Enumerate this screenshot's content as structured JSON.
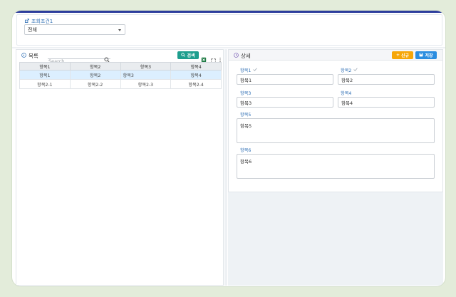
{
  "colors": {
    "accent_navy": "#2c3d9c",
    "label_blue": "#2f6fb5",
    "search_button": "#1e9e8e",
    "new_button": "#f6a609",
    "save_button": "#2b8de0",
    "selected_row": "#dcefff"
  },
  "condition": {
    "title": "조회조건1",
    "select_value": "전체"
  },
  "list_panel": {
    "title": "목록",
    "search_placeholder": "Search",
    "search_button_label": "검색",
    "columns": [
      "항목1",
      "항목2",
      "항목3",
      "항목4"
    ],
    "rows": [
      [
        "항목1",
        "항목2",
        "항목3",
        "항목4"
      ],
      [
        "항목2-1",
        "항목2-2",
        "항목2-3",
        "항목2-4"
      ]
    ]
  },
  "detail_panel": {
    "title": "상세",
    "new_button_label": "신규",
    "save_button_label": "저장",
    "fields": [
      {
        "label": "항목1",
        "value": "항목1"
      },
      {
        "label": "항목2",
        "value": "항목2"
      },
      {
        "label": "항목3",
        "value": "항목3"
      },
      {
        "label": "항목4",
        "value": "항목4"
      },
      {
        "label": "항목5",
        "value": "항목5"
      },
      {
        "label": "항목6",
        "value": "항목6"
      }
    ]
  }
}
